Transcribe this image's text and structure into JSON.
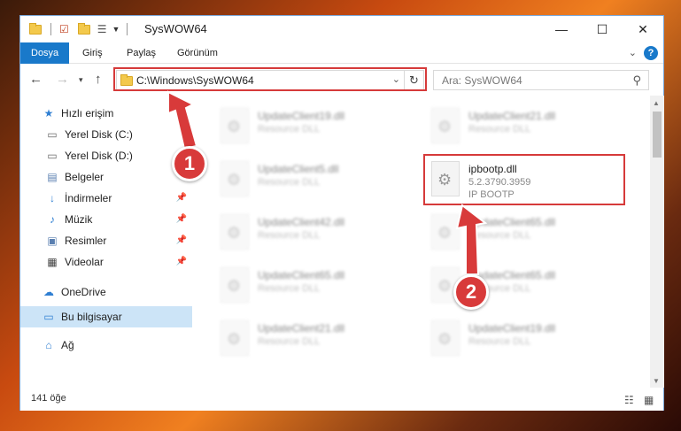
{
  "window": {
    "title": "SysWOW64",
    "controls": {
      "minimize": "—",
      "maximize": "☐",
      "close": "✕"
    }
  },
  "ribbon": {
    "tabs": [
      "Dosya",
      "Giriş",
      "Paylaş",
      "Görünüm"
    ]
  },
  "navigation": {
    "address": "C:\\Windows\\SysWOW64",
    "search_placeholder": "Ara: SysWOW64"
  },
  "sidebar": {
    "items": [
      {
        "label": "Hızlı erişim",
        "icon": "star-icon"
      },
      {
        "label": "Yerel Disk (C:)",
        "icon": "drive-icon"
      },
      {
        "label": "Yerel Disk (D:)",
        "icon": "drive-icon"
      },
      {
        "label": "Belgeler",
        "icon": "documents-icon"
      },
      {
        "label": "İndirmeler",
        "icon": "download-icon"
      },
      {
        "label": "Müzik",
        "icon": "music-icon"
      },
      {
        "label": "Resimler",
        "icon": "pictures-icon"
      },
      {
        "label": "Videolar",
        "icon": "video-icon"
      },
      {
        "label": "OneDrive",
        "icon": "cloud-icon"
      },
      {
        "label": "Bu bilgisayar",
        "icon": "computer-icon"
      },
      {
        "label": "Ağ",
        "icon": "network-icon"
      }
    ]
  },
  "files": [
    {
      "name": "UpdateClient19.dll",
      "type": "Resource DLL"
    },
    {
      "name": "UpdateClient21.dll",
      "type": "Resource DLL"
    },
    {
      "name": "UpdateClient5.dll",
      "type": "Resource DLL"
    },
    {
      "name": "ipbootp.dll",
      "version": "5.2.3790.3959",
      "description": "IP BOOTP"
    },
    {
      "name": "UpdateClient42.dll",
      "type": "Resource DLL"
    },
    {
      "name": "UpdateClient65.dll",
      "type": "Resource DLL"
    },
    {
      "name": "UpdateClient65.dll",
      "type": "Resource DLL"
    },
    {
      "name": "UpdateClient65.dll",
      "type": "Resource DLL"
    },
    {
      "name": "UpdateClient21.dll",
      "type": "Resource DLL"
    },
    {
      "name": "UpdateClient19.dll",
      "type": "Resource DLL"
    }
  ],
  "status": {
    "item_count": "141 öğe"
  },
  "annotations": {
    "step1": "1",
    "step2": "2",
    "highlight_color": "#d63a3a"
  }
}
